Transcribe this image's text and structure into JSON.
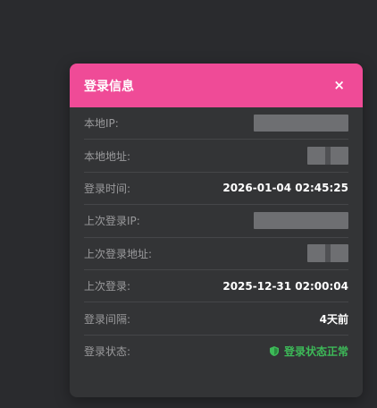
{
  "modal": {
    "title": "登录信息",
    "close_label": "×"
  },
  "rows": [
    {
      "label": "本地IP:",
      "value": ""
    },
    {
      "label": "本地地址:",
      "value": ""
    },
    {
      "label": "登录时间:",
      "value": "2026-01-04 02:45:25"
    },
    {
      "label": "上次登录IP:",
      "value": ""
    },
    {
      "label": "上次登录地址:",
      "value": ""
    },
    {
      "label": "上次登录:",
      "value": "2025-12-31 02:00:04"
    },
    {
      "label": "登录间隔:",
      "value": "4天前"
    },
    {
      "label": "登录状态:",
      "value": "登录状态正常",
      "icon": "shield-icon"
    }
  ],
  "colors": {
    "header": "#ef4b97",
    "status_ok": "#3dba58",
    "background": "#2a2b2e",
    "panel": "#333436"
  }
}
